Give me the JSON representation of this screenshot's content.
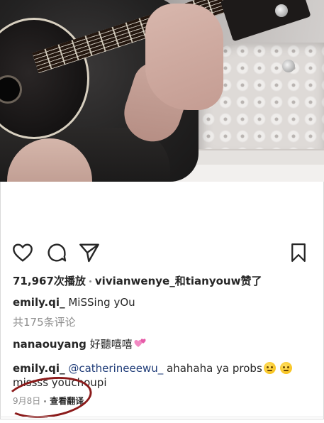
{
  "post": {
    "views_count": "71,967",
    "views_suffix": "次播放",
    "likers_1": "vivianwenye",
    "likers_join": "_和",
    "likers_2": "tianyouw",
    "likers_suffix": "赞了"
  },
  "caption": {
    "username": "emily.qi_",
    "text": "MiSSing yOu"
  },
  "comments_summary": "共175条评论",
  "comments": [
    {
      "username": "nanaouyang",
      "text": "好聽嘻嘻"
    },
    {
      "username": "emily.qi_",
      "mention": "@catherineeewu_",
      "text": "ahahaha ya probs",
      "text_line2": "missss youchoupi"
    }
  ],
  "meta": {
    "date": "9月8日",
    "translate": "查看翻译"
  },
  "icons": {
    "like": "heart-icon",
    "comment": "comment-icon",
    "share": "send-icon",
    "save": "bookmark-icon"
  },
  "colors": {
    "text": "#262626",
    "muted": "#8e8e8e",
    "mention": "#1f3c78",
    "annotation_circle": "#8b1a1a"
  }
}
